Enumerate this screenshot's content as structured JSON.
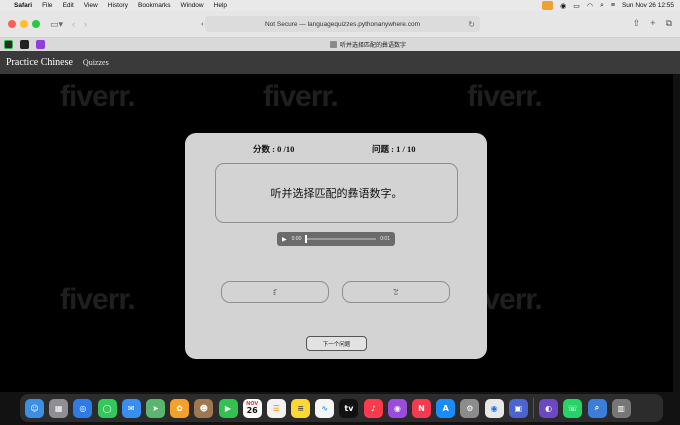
{
  "menubar": {
    "app_name": "Safari",
    "items": [
      "File",
      "Edit",
      "View",
      "History",
      "Bookmarks",
      "Window",
      "Help"
    ],
    "date_time": "Sun Nov 26  12:55"
  },
  "toolbar": {
    "address_text": "Not Secure — languagequizzes.pythonanywhere.com"
  },
  "tab": {
    "title": "听并选择匹配的彝语数字"
  },
  "site": {
    "brand": "Practice Chinese",
    "nav_quizzes": "Quizzes"
  },
  "watermark": "fiverr.",
  "quiz": {
    "score_label": "分数 : 0 /10",
    "question_label": "问题 : 1 / 10",
    "prompt": "听并选择匹配的彝语数字。",
    "audio_current": "0:00",
    "audio_duration": "0:01",
    "answer_1": "ꆏ",
    "answer_2": "ꇖ",
    "next_label": "下一个问题"
  },
  "dock": {
    "icons": [
      "finder-icon",
      "launchpad-icon",
      "safari-icon",
      "messages-icon",
      "mail-icon",
      "maps-icon",
      "photos-icon",
      "contacts-icon",
      "facetime-icon",
      "calendar-icon",
      "reminders-icon",
      "notes-icon",
      "freeform-icon",
      "appletv-icon",
      "music-icon",
      "podcasts-icon",
      "news-icon",
      "appstore-icon",
      "settings-icon",
      "chrome-icon",
      "preview-icon",
      "github-icon",
      "whatsapp-icon",
      "finder-search-icon",
      "trash-icon"
    ],
    "calendar_month": "NOV",
    "calendar_day": "26",
    "tv_label": "tv"
  }
}
